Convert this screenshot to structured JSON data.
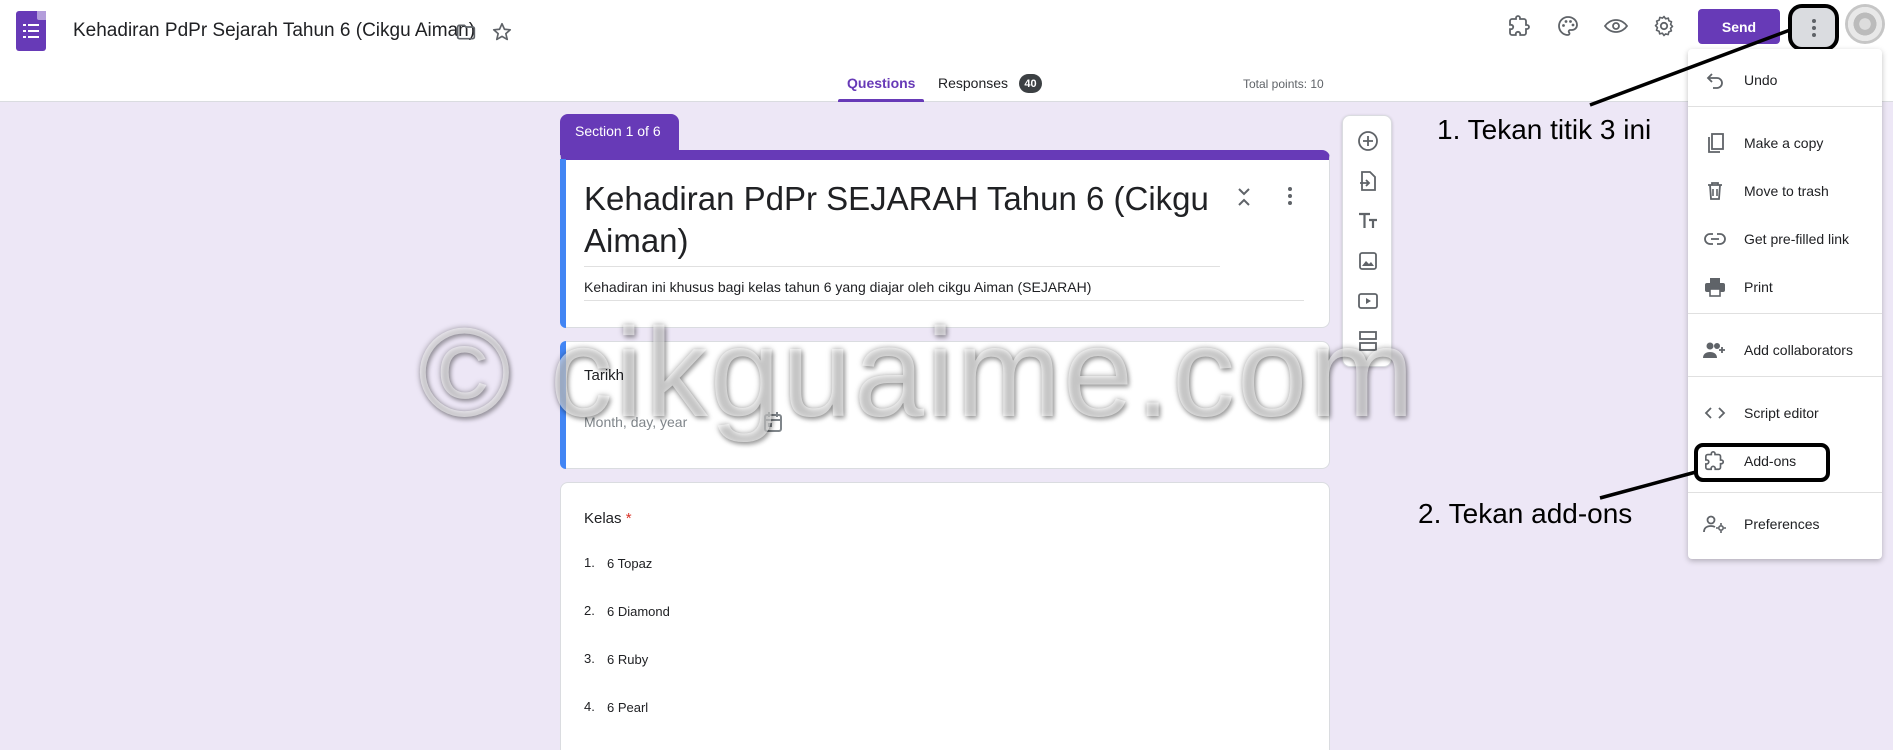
{
  "header": {
    "form_title": "Kehadiran PdPr Sejarah Tahun 6 (Cikgu Aiman)",
    "send_label": "Send",
    "icons": [
      "folder-icon",
      "star-icon",
      "addons-icon",
      "palette-icon",
      "preview-icon",
      "settings-icon",
      "more-vert-icon"
    ]
  },
  "tabs": {
    "questions": "Questions",
    "responses": "Responses",
    "responses_count": "40",
    "total_points": "Total points: 10"
  },
  "section": {
    "label": "Section 1 of 6",
    "title": "Kehadiran PdPr SEJARAH Tahun 6 (Cikgu Aiman)",
    "description": "Kehadiran ini khusus bagi kelas tahun 6  yang diajar oleh cikgu Aiman (SEJARAH)"
  },
  "questions": [
    {
      "title": "Tarikh",
      "placeholder": "Month, day, year"
    },
    {
      "title": "Kelas",
      "required_mark": "*",
      "options": [
        {
          "num": "1.",
          "label": "6 Topaz"
        },
        {
          "num": "2.",
          "label": "6 Diamond"
        },
        {
          "num": "3.",
          "label": "6 Ruby"
        },
        {
          "num": "4.",
          "label": "6 Pearl"
        }
      ]
    }
  ],
  "menu": {
    "items": [
      {
        "label": "Undo",
        "icon": "undo-icon"
      },
      {
        "label": "Make a copy",
        "icon": "copy-icon"
      },
      {
        "label": "Move to trash",
        "icon": "trash-icon"
      },
      {
        "label": "Get pre-filled link",
        "icon": "link-icon"
      },
      {
        "label": "Print",
        "icon": "print-icon"
      },
      {
        "label": "Add collaborators",
        "icon": "add-people-icon"
      },
      {
        "label": "Script editor",
        "icon": "code-icon"
      },
      {
        "label": "Add-ons",
        "icon": "addons-icon"
      },
      {
        "label": "Preferences",
        "icon": "preferences-icon"
      }
    ]
  },
  "annotations": {
    "step1": "1. Tekan titik 3 ini",
    "step2": "2. Tekan add-ons"
  },
  "watermark": "© cikguaime.com",
  "colors": {
    "accent": "#673ab7",
    "background": "#ede7f6",
    "focus_bar": "#4285f4",
    "required": "#d93025"
  }
}
